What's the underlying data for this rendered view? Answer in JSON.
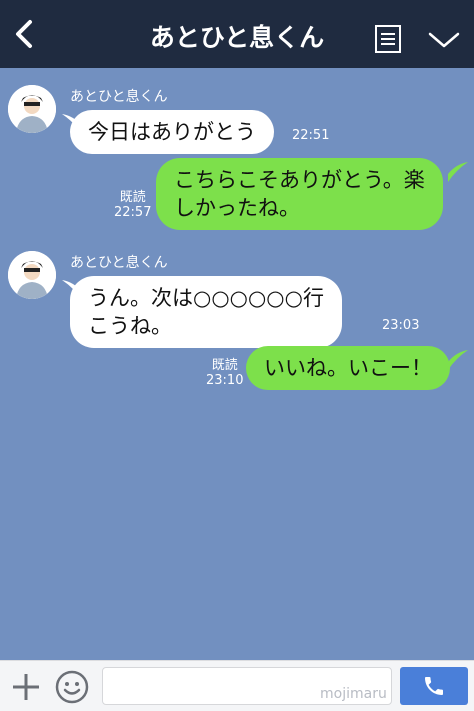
{
  "header": {
    "title": "あとひと息くん",
    "icons": {
      "back": "chevron-left-icon",
      "notes": "note-list-icon",
      "menu": "chevron-down-icon"
    }
  },
  "messages": [
    {
      "direction": "in",
      "sender": "あとひと息くん",
      "lines": [
        "今日はありがとう"
      ],
      "time": "22:51"
    },
    {
      "direction": "out",
      "lines": [
        "こちらこそありがとう。楽",
        "しかったね。"
      ],
      "read": "既読",
      "time": "22:57"
    },
    {
      "direction": "in",
      "sender": "あとひと息くん",
      "lines": [
        "うん。次は○○○○○○行",
        "こうね。"
      ],
      "time": "23:03"
    },
    {
      "direction": "out",
      "lines": [
        "いいね。いこー！"
      ],
      "read": "既読",
      "time": "23:10"
    }
  ],
  "footer": {
    "input_value": "",
    "watermark": "mojimaru",
    "icons": {
      "add": "plus-icon",
      "emoji": "smiley-icon",
      "call": "phone-icon"
    }
  },
  "colors": {
    "chat_bg": "#7290c0",
    "header_bg": "#1f2b40",
    "bubble_in": "#ffffff",
    "bubble_out": "#7de04b",
    "call_button": "#4a7fd9"
  }
}
